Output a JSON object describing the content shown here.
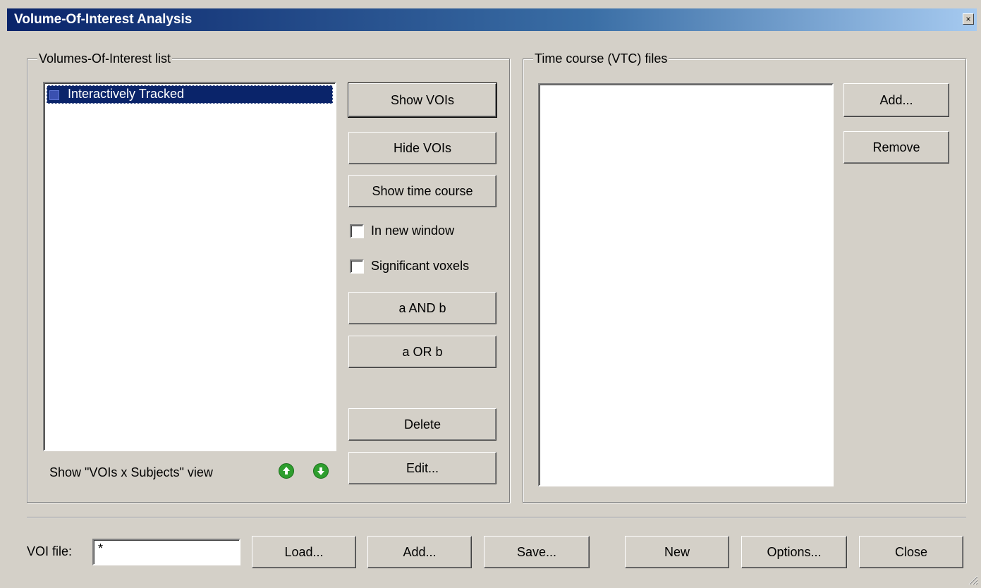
{
  "window": {
    "title": "Volume-Of-Interest Analysis",
    "close_glyph": "×"
  },
  "voi_group": {
    "legend": "Volumes-Of-Interest list",
    "items": [
      {
        "label": "Interactively Tracked",
        "selected": true,
        "color": "#3a50b0"
      }
    ],
    "show_voi_x_subjects_label": "Show \"VOIs x Subjects\" view",
    "move_up_icon": "arrow-up-circle",
    "move_down_icon": "arrow-down-circle",
    "buttons": {
      "show_vois": "Show VOIs",
      "hide_vois": "Hide VOIs",
      "show_time_course": "Show time course",
      "a_and_b": "a AND b",
      "a_or_b": "a OR b",
      "delete": "Delete",
      "edit": "Edit..."
    },
    "checkboxes": {
      "in_new_window": {
        "label": "In new window",
        "checked": false
      },
      "significant_voxels": {
        "label": "Significant voxels",
        "checked": false
      }
    }
  },
  "vtc_group": {
    "legend": "Time course (VTC) files",
    "items": [],
    "buttons": {
      "add": "Add...",
      "remove": "Remove"
    }
  },
  "footer": {
    "voi_file_label": "VOI file:",
    "voi_file_value": "*",
    "buttons": {
      "load": "Load...",
      "add": "Add...",
      "save": "Save...",
      "new": "New",
      "options": "Options...",
      "close": "Close"
    }
  },
  "colors": {
    "dialog_bg": "#d4d0c8",
    "title_start": "#0a246a",
    "title_end": "#a6caf0",
    "selection": "#0a246a",
    "arrow_green": "#2e9e2e"
  }
}
